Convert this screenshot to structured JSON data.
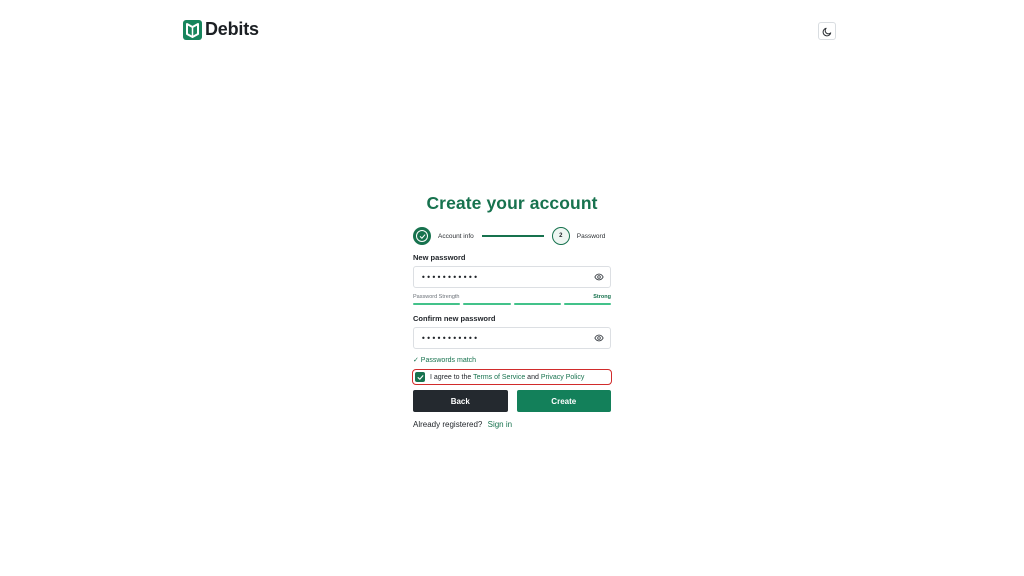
{
  "app": {
    "brand_name": "Debits",
    "brand_color": "#17724e",
    "logo_icon": "debits-logo-icon",
    "theme_toggle_icon": "moon-icon"
  },
  "form": {
    "title": "Create your account",
    "steps": [
      {
        "label": "Account info",
        "state": "completed",
        "icon": "check-circle-icon"
      },
      {
        "label": "Password",
        "state": "current",
        "number": "2"
      }
    ],
    "new_password": {
      "label": "New password",
      "value": "•••••••••••",
      "toggle_icon": "eye-icon"
    },
    "strength": {
      "label": "Password Strength",
      "value": "Strong",
      "filled_segments": 4,
      "total_segments": 4,
      "color": "#43c28a"
    },
    "confirm_password": {
      "label": "Confirm new password",
      "value": "•••••••••••",
      "toggle_icon": "eye-icon"
    },
    "match_text": "✓ Passwords match",
    "agree": {
      "checked": true,
      "prefix": "I agree to the",
      "terms_link": "Terms of Service",
      "conjunction": "and",
      "privacy_link": "Privacy Policy",
      "highlight_color": "#d12b2b"
    },
    "back_label": "Back",
    "create_label": "Create",
    "signin_prompt": "Already registered?",
    "signin_link": "Sign in"
  }
}
